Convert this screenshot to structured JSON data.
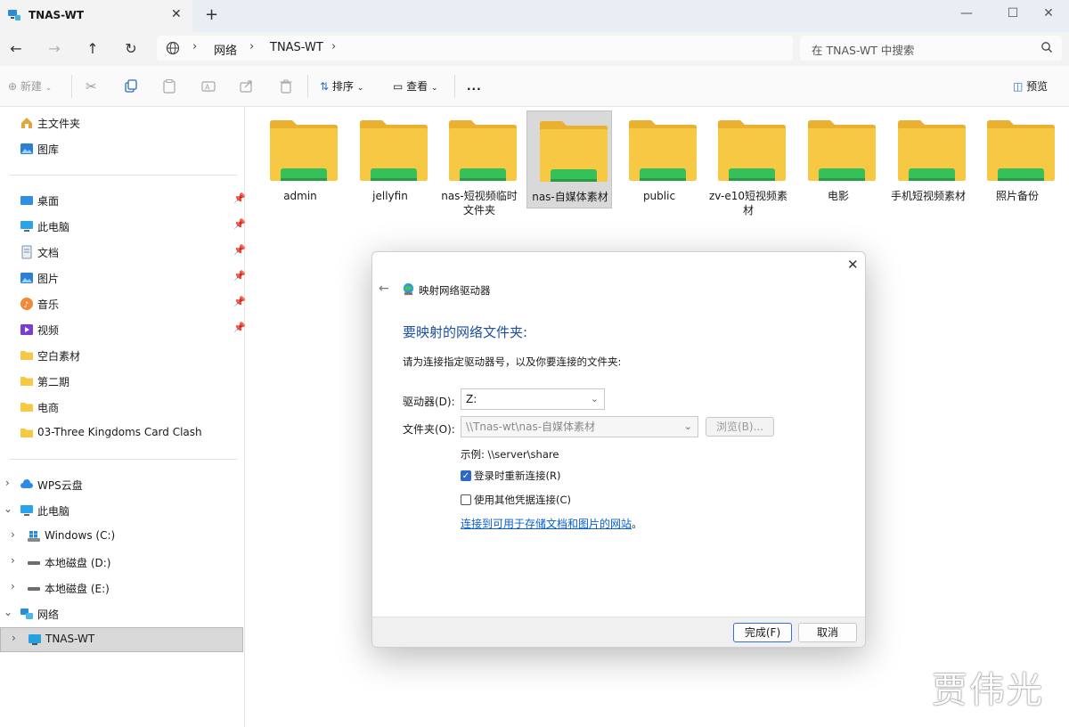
{
  "window": {
    "tab_title": "TNAS-WT",
    "new_tab": "+",
    "close_tab": "✕"
  },
  "address": {
    "crumbs": [
      "网络",
      "TNAS-WT"
    ],
    "search_placeholder": "在 TNAS-WT 中搜索"
  },
  "toolbar": {
    "new_label": "新建",
    "sort_label": "排序",
    "view_label": "查看",
    "more_label": "...",
    "preview_label": "预览"
  },
  "sidebar": {
    "quick": [
      {
        "label": "主文件夹"
      },
      {
        "label": "图库"
      }
    ],
    "pinned": [
      {
        "label": "桌面"
      },
      {
        "label": "此电脑"
      },
      {
        "label": "文档"
      },
      {
        "label": "图片"
      },
      {
        "label": "音乐"
      },
      {
        "label": "视频"
      },
      {
        "label": "空白素材"
      },
      {
        "label": "第二期"
      },
      {
        "label": "电商"
      },
      {
        "label": "03-Three Kingdoms Card Clash"
      }
    ],
    "tree": [
      {
        "label": "WPS云盘"
      },
      {
        "label": "此电脑"
      },
      {
        "label": "Windows  (C:)"
      },
      {
        "label": "本地磁盘 (D:)"
      },
      {
        "label": "本地磁盘 (E:)"
      },
      {
        "label": "网络"
      },
      {
        "label": "TNAS-WT"
      }
    ]
  },
  "folders": [
    {
      "line1": "admin",
      "line2": ""
    },
    {
      "line1": "jellyfin",
      "line2": ""
    },
    {
      "line1": "nas-短视频临时",
      "line2": "文件夹"
    },
    {
      "line1": "nas-自媒体素材",
      "line2": ""
    },
    {
      "line1": "public",
      "line2": ""
    },
    {
      "line1": "zv-e10短视频素",
      "line2": "材"
    },
    {
      "line1": "电影",
      "line2": ""
    },
    {
      "line1": "手机短视频素材",
      "line2": ""
    },
    {
      "line1": "照片备份",
      "line2": ""
    }
  ],
  "dialog": {
    "title": "映射网络驱动器",
    "heading": "要映射的网络文件夹:",
    "instruction": "请为连接指定驱动器号，以及你要连接的文件夹:",
    "drive_label": "驱动器(D):",
    "drive_value": "Z:",
    "folder_label": "文件夹(O):",
    "folder_value": "\\\\Tnas-wt\\nas-自媒体素材",
    "browse_label": "浏览(B)...",
    "example": "示例: \\\\server\\share",
    "reconnect_label": "登录时重新连接(R)",
    "reconnect_checked": true,
    "other_creds_label": "使用其他凭据连接(C)",
    "other_creds_checked": false,
    "link_text": "连接到可用于存储文档和图片的网站",
    "link_suffix": "。",
    "finish_label": "完成(F)",
    "cancel_label": "取消"
  },
  "watermark": "贾伟光",
  "colors": {
    "accent": "#2f66c8",
    "heading_blue": "#1e4fa0",
    "folder_yellow": "#f6c843",
    "nas_green": "#36c05a"
  }
}
